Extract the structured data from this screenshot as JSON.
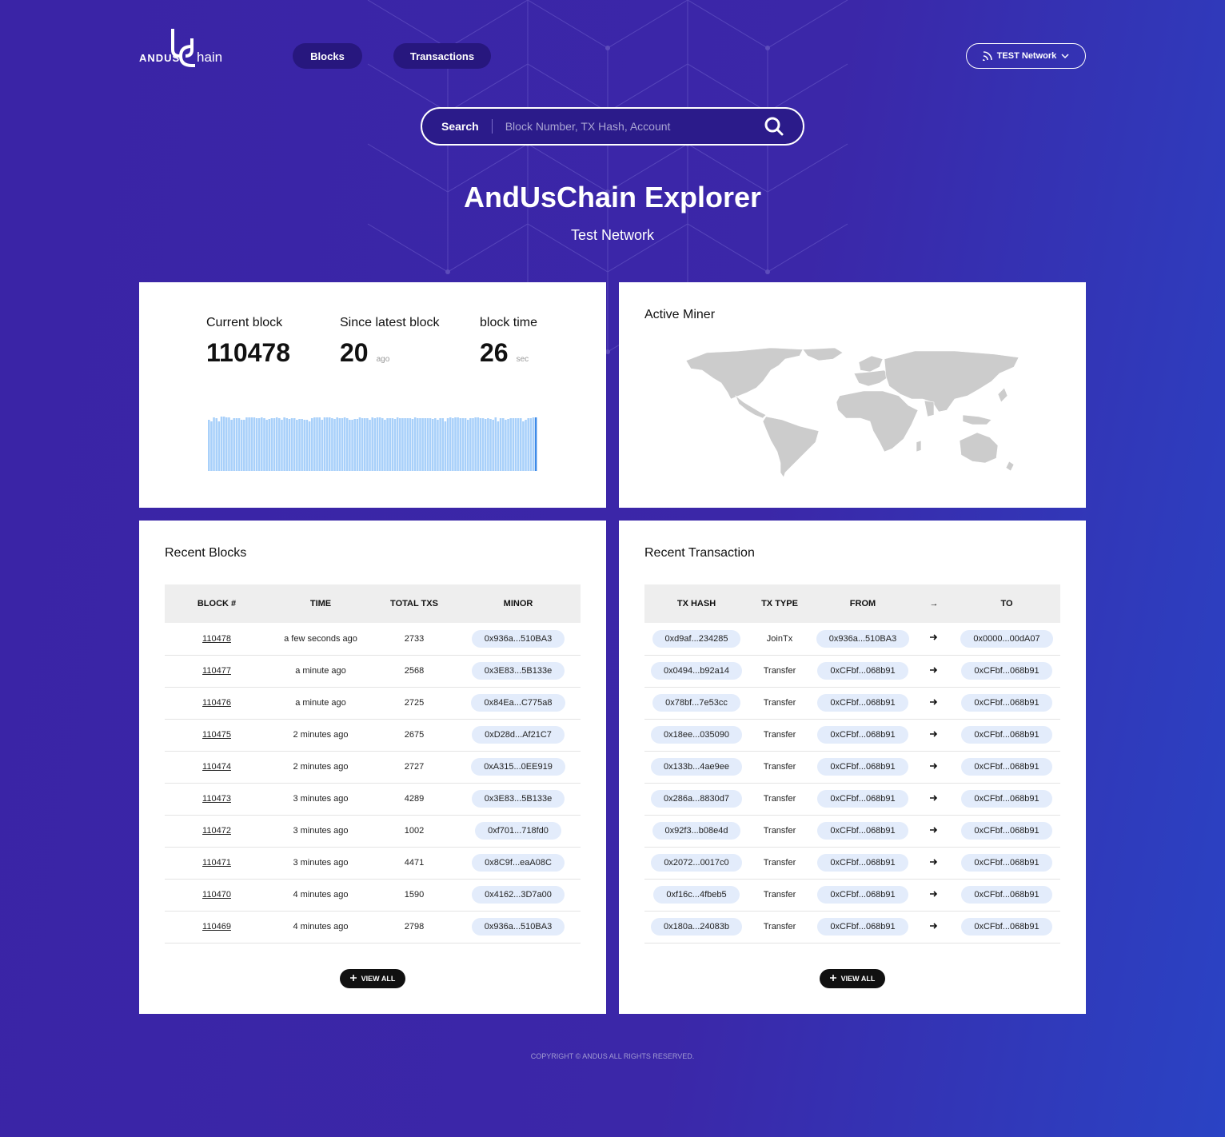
{
  "brand": {
    "logo_text": "ANDUS Chain",
    "logo_left": "ANDUS",
    "logo_right": "hain"
  },
  "nav": {
    "blocks_label": "Blocks",
    "transactions_label": "Transactions",
    "network_label": "TEST Network"
  },
  "search": {
    "label": "Search",
    "placeholder": "Block Number, TX Hash, Account"
  },
  "hero": {
    "title": "AndUsChain Explorer",
    "subtitle": "Test Network"
  },
  "stats": {
    "current_block_label": "Current block",
    "current_block_value": "110478",
    "since_latest_label": "Since latest block",
    "since_latest_value": "20",
    "since_latest_unit": "ago",
    "block_time_label": "block time",
    "block_time_value": "26",
    "block_time_unit": "sec"
  },
  "block_time_bars": [
    64,
    62,
    67,
    66,
    62,
    68,
    68,
    67,
    67,
    64,
    66,
    66,
    66,
    64,
    64,
    67,
    67,
    67,
    67,
    66,
    66,
    67,
    66,
    64,
    65,
    66,
    66,
    67,
    66,
    64,
    67,
    66,
    65,
    66,
    66,
    64,
    65,
    65,
    64,
    64,
    62,
    66,
    67,
    67,
    67,
    64,
    67,
    67,
    67,
    66,
    65,
    67,
    66,
    66,
    67,
    66,
    64,
    64,
    65,
    65,
    67,
    66,
    66,
    66,
    64,
    67,
    66,
    67,
    67,
    66,
    64,
    66,
    66,
    66,
    65,
    67,
    66,
    66,
    66,
    66,
    66,
    65,
    67,
    66,
    66,
    66,
    66,
    66,
    66,
    65,
    66,
    64,
    66,
    66,
    62,
    66,
    67,
    66,
    67,
    67,
    66,
    66,
    66,
    64,
    66,
    66,
    67,
    67,
    66,
    66,
    65,
    66,
    65,
    64,
    67,
    62,
    66,
    66,
    64,
    65,
    66,
    66,
    66,
    66,
    66,
    62,
    64,
    66,
    66,
    67,
    67
  ],
  "miner": {
    "title": "Active Miner"
  },
  "recent_blocks": {
    "title": "Recent Blocks",
    "columns": [
      "BLOCK #",
      "TIME",
      "TOTAL TXS",
      "MINOR"
    ],
    "rows": [
      {
        "block": "110478",
        "time": "a few seconds ago",
        "txs": "2733",
        "miner": "0x936a...510BA3"
      },
      {
        "block": "110477",
        "time": "a minute ago",
        "txs": "2568",
        "miner": "0x3E83...5B133e"
      },
      {
        "block": "110476",
        "time": "a minute ago",
        "txs": "2725",
        "miner": "0x84Ea...C775a8"
      },
      {
        "block": "110475",
        "time": "2 minutes ago",
        "txs": "2675",
        "miner": "0xD28d...Af21C7"
      },
      {
        "block": "110474",
        "time": "2 minutes ago",
        "txs": "2727",
        "miner": "0xA315...0EE919"
      },
      {
        "block": "110473",
        "time": "3 minutes ago",
        "txs": "4289",
        "miner": "0x3E83...5B133e"
      },
      {
        "block": "110472",
        "time": "3 minutes ago",
        "txs": "1002",
        "miner": "0xf701...718fd0"
      },
      {
        "block": "110471",
        "time": "3 minutes ago",
        "txs": "4471",
        "miner": "0x8C9f...eaA08C"
      },
      {
        "block": "110470",
        "time": "4 minutes ago",
        "txs": "1590",
        "miner": "0x4162...3D7a00"
      },
      {
        "block": "110469",
        "time": "4 minutes ago",
        "txs": "2798",
        "miner": "0x936a...510BA3"
      }
    ],
    "view_all": "VIEW ALL"
  },
  "recent_tx": {
    "title": "Recent Transaction",
    "columns": [
      "TX HASH",
      "TX TYPE",
      "FROM",
      "→",
      "TO"
    ],
    "rows": [
      {
        "hash": "0xd9af...234285",
        "type": "JoinTx",
        "from": "0x936a...510BA3",
        "to": "0x0000...00dA07"
      },
      {
        "hash": "0x0494...b92a14",
        "type": "Transfer",
        "from": "0xCFbf...068b91",
        "to": "0xCFbf...068b91"
      },
      {
        "hash": "0x78bf...7e53cc",
        "type": "Transfer",
        "from": "0xCFbf...068b91",
        "to": "0xCFbf...068b91"
      },
      {
        "hash": "0x18ee...035090",
        "type": "Transfer",
        "from": "0xCFbf...068b91",
        "to": "0xCFbf...068b91"
      },
      {
        "hash": "0x133b...4ae9ee",
        "type": "Transfer",
        "from": "0xCFbf...068b91",
        "to": "0xCFbf...068b91"
      },
      {
        "hash": "0x286a...8830d7",
        "type": "Transfer",
        "from": "0xCFbf...068b91",
        "to": "0xCFbf...068b91"
      },
      {
        "hash": "0x92f3...b08e4d",
        "type": "Transfer",
        "from": "0xCFbf...068b91",
        "to": "0xCFbf...068b91"
      },
      {
        "hash": "0x2072...0017c0",
        "type": "Transfer",
        "from": "0xCFbf...068b91",
        "to": "0xCFbf...068b91"
      },
      {
        "hash": "0xf16c...4fbeb5",
        "type": "Transfer",
        "from": "0xCFbf...068b91",
        "to": "0xCFbf...068b91"
      },
      {
        "hash": "0x180a...24083b",
        "type": "Transfer",
        "from": "0xCFbf...068b91",
        "to": "0xCFbf...068b91"
      }
    ],
    "view_all": "VIEW ALL"
  },
  "footer": {
    "copyright": "COPYRIGHT © ANDUS ALL RIGHTS RESERVED."
  },
  "colors": {
    "background": "#3a24a6",
    "nav_pill": "#27177e",
    "bar_fill": "#a8d0fa",
    "bar_latest": "#3d8ae8",
    "pill_bg": "#e3ecfb"
  }
}
